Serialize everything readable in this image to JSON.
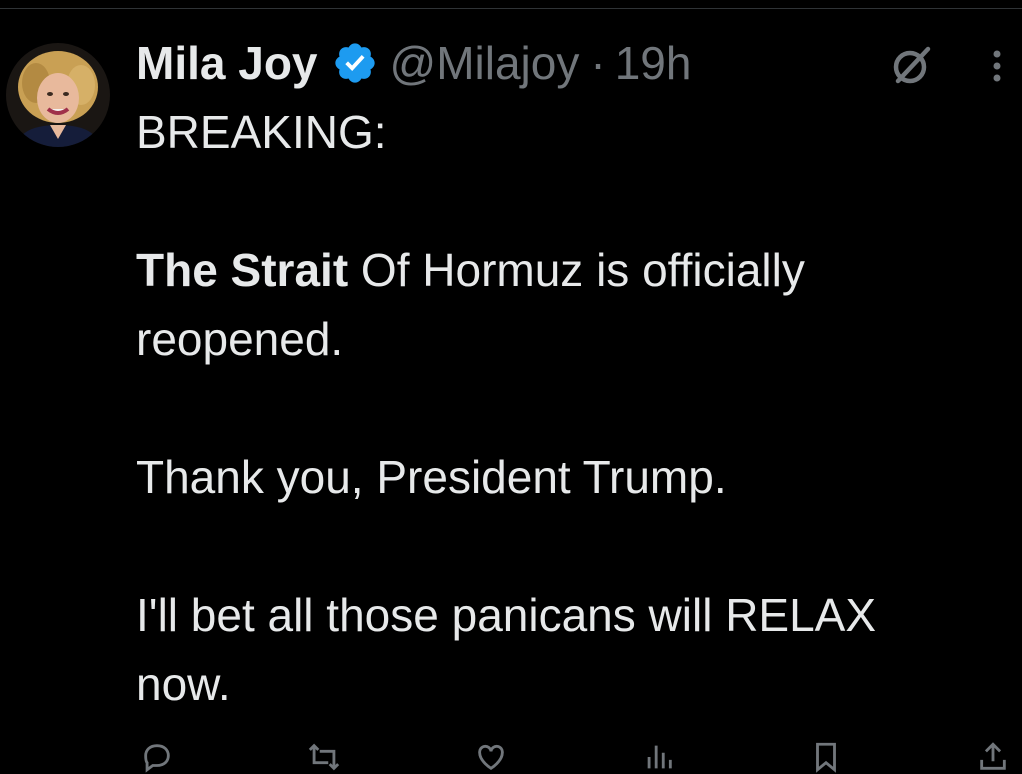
{
  "tweet": {
    "display_name": "Mila Joy",
    "handle": "@Milajoy",
    "separator": "·",
    "time": "19h",
    "verified": true,
    "badge_color": "#1d9bf0",
    "avatar_icon": "avatar-photo",
    "line1": "BREAKING:",
    "line2_bold": "The Strait",
    "line2_rest": " Of Hormuz is officially",
    "line3": "reopened.",
    "line4": "Thank you, President Trump.",
    "line5": "I'll bet all those panicans will RELAX",
    "line6": "now."
  },
  "actions": {
    "reply_icon": "reply-icon",
    "retweet_icon": "retweet-icon",
    "like_icon": "like-icon",
    "views_icon": "views-icon",
    "bookmark_icon": "bookmark-icon",
    "share_icon": "share-icon"
  },
  "header_icons": {
    "grok": "grok-icon",
    "more": "more-icon"
  }
}
